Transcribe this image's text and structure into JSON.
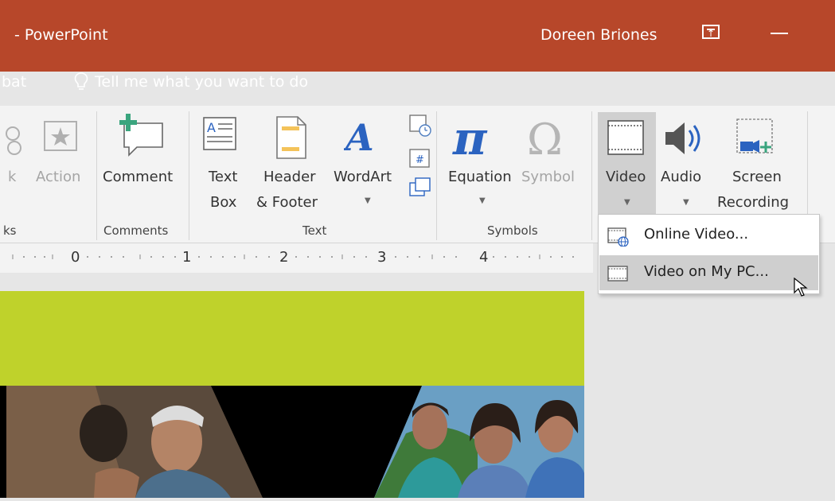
{
  "titlebar": {
    "app_title": " - PowerPoint",
    "user": "Doreen Briones"
  },
  "tabs": {
    "acrobat_partial": "bat",
    "tell_me": "Tell me what you want to do"
  },
  "ribbon": {
    "links_partial": "k",
    "action": "Action",
    "comment": "Comment",
    "text_box_line1": "Text",
    "text_box_line2": "Box",
    "header_line1": "Header",
    "header_line2": "& Footer",
    "wordart": "WordArt",
    "equation": "Equation",
    "symbol": "Symbol",
    "video": "Video",
    "audio": "Audio",
    "screen_line1": "Screen",
    "screen_line2": "Recording",
    "groups": {
      "links_partial": "ks",
      "comments": "Comments",
      "text": "Text",
      "symbols": "Symbols"
    }
  },
  "ruler": {
    "marks": [
      "0",
      "1",
      "2",
      "3",
      "4"
    ]
  },
  "video_menu": {
    "items": [
      {
        "label": "Online Video...",
        "icon": "online-video-icon"
      },
      {
        "label": "Video on My PC...",
        "icon": "video-file-icon"
      }
    ]
  },
  "colors": {
    "titlebar": "#b7472a",
    "ribbon": "#f3f3f3",
    "slide_green": "#bfd22b",
    "slide_black": "#000000",
    "accent_green": "#4da386",
    "accent_yellow": "#f4c35a",
    "accent_blue": "#2b63c0"
  }
}
